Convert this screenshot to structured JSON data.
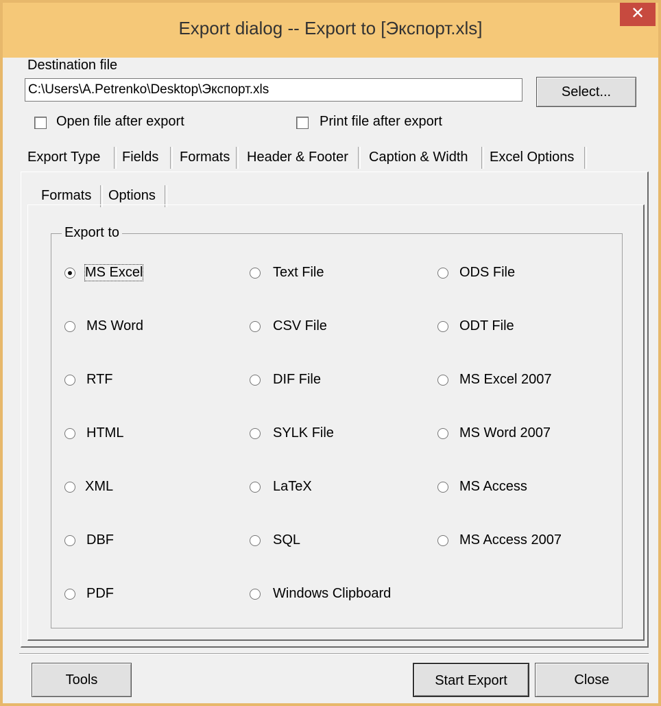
{
  "window": {
    "title": "Export dialog -- Export to [Экспорт.xls]",
    "close_glyph": "✕"
  },
  "destination": {
    "label": "Destination file",
    "value": "C:\\Users\\A.Petrenko\\Desktop\\Экспорт.xls",
    "select_label": "Select..."
  },
  "options": {
    "open_after": {
      "label": "Open file after export",
      "checked": false
    },
    "print_after": {
      "label": "Print file after export",
      "checked": false
    }
  },
  "tabs": [
    {
      "label": "Export Type",
      "active": true
    },
    {
      "label": "Fields"
    },
    {
      "label": "Formats"
    },
    {
      "label": "Header & Footer"
    },
    {
      "label": "Caption & Width"
    },
    {
      "label": "Excel Options"
    }
  ],
  "subtabs": [
    {
      "label": "Formats",
      "active": true
    },
    {
      "label": "Options"
    }
  ],
  "export_group": {
    "label": "Export to",
    "formats": [
      "MS Excel",
      "MS Word",
      "RTF",
      "HTML",
      "XML",
      "DBF",
      "PDF",
      "Text File",
      "CSV File",
      "DIF File",
      "SYLK File",
      "LaTeX",
      "SQL",
      "Windows Clipboard",
      "ODS File",
      "ODT File",
      "MS Excel 2007",
      "MS Word 2007",
      "MS Access",
      "MS Access 2007"
    ],
    "selected": "MS Excel"
  },
  "footer": {
    "tools_label": "Tools",
    "start_label": "Start Export",
    "close_label": "Close"
  }
}
